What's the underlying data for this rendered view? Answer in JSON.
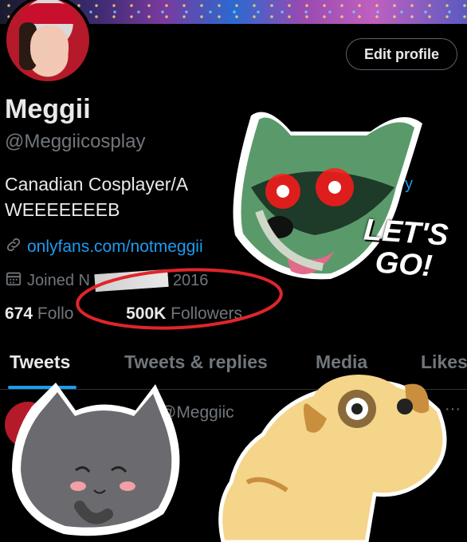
{
  "profile": {
    "edit_label": "Edit profile",
    "name": "Meggii",
    "handle": "@Meggiicosplay",
    "bio_line1": "Canadian Cosplayer/A",
    "bio_line1_tail": "y",
    "bio_line2": "WEEEEEEEB",
    "link": "onlyfans.com/notmeggii",
    "joined": "Joined N",
    "joined_tail": "2016",
    "following_count": "674",
    "following_label": "Follo",
    "followers_count": "500K",
    "followers_label": "Followers"
  },
  "tabs": [
    {
      "label": "Tweets"
    },
    {
      "label": "Tweets & replies"
    },
    {
      "label": "Media"
    },
    {
      "label": "Likes"
    }
  ],
  "tweet": {
    "handle": "@Meggiic",
    "more": "···"
  },
  "stickers": {
    "raccoon_text_line1": "LET'S",
    "raccoon_text_line2": "GO!"
  },
  "colors": {
    "accent": "#1d9bf0",
    "background": "#000000",
    "circle": "#e0252a"
  }
}
